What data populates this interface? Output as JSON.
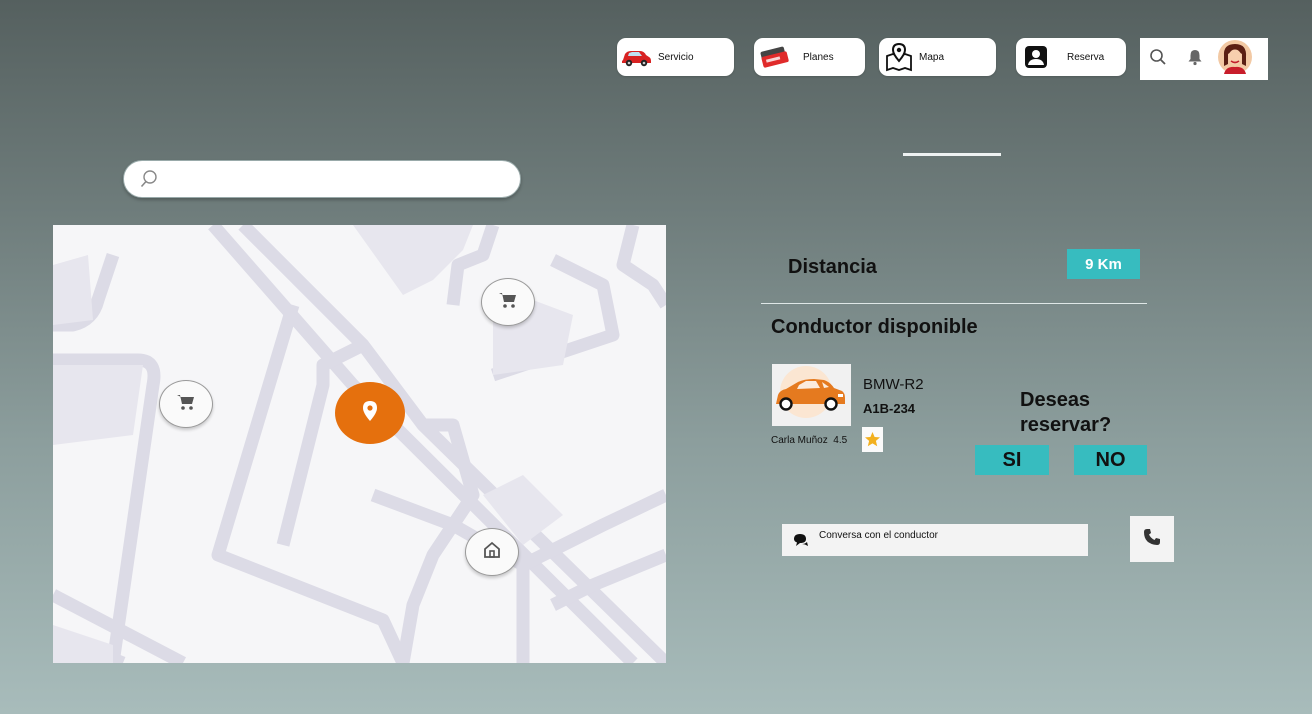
{
  "nav": {
    "servicio": {
      "label": "Servicio",
      "icon": "red-car-icon"
    },
    "planes": {
      "label": "Planes",
      "icon": "plans-ticket-icon"
    },
    "mapa": {
      "label": "Mapa",
      "icon": "map-pin-icon"
    },
    "reserva": {
      "label": "Reserva",
      "icon": "user-card-icon"
    }
  },
  "header_right": {
    "icons": [
      "search-icon",
      "bell-icon",
      "avatar"
    ]
  },
  "search": {
    "placeholder": "",
    "value": ""
  },
  "map": {
    "markers": [
      "cart-icon",
      "cart-icon",
      "location-pin-icon",
      "home-icon"
    ]
  },
  "trip": {
    "distance_label": "Distancia",
    "distance_value": "9 Km",
    "driver_heading": "Conductor disponible",
    "car_model": "BMW-R2",
    "plate": "A1B-234",
    "driver_name": "Carla Muñoz",
    "rating": "4.5"
  },
  "reserve": {
    "question_line1": "Deseas",
    "question_line2": "reservar?",
    "yes": "SI",
    "no": "NO"
  },
  "chat": {
    "placeholder": "Conversa con el conductor"
  },
  "colors": {
    "accent": "#37bcbf",
    "map_pin": "#e5700d",
    "car": "#e57a1f"
  }
}
